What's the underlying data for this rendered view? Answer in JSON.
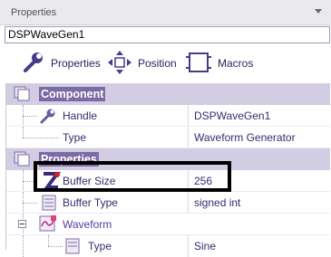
{
  "panel": {
    "title": "Properties"
  },
  "object_selector": {
    "value": "DSPWaveGen1"
  },
  "toolbar": {
    "properties_label": "Properties",
    "position_label": "Position",
    "macros_label": "Macros"
  },
  "categories": {
    "component": {
      "label": "Component"
    },
    "properties": {
      "label": "Properties"
    },
    "waveform": {
      "label": "Waveform"
    }
  },
  "rows": {
    "handle": {
      "name": "Handle",
      "value": "DSPWaveGen1"
    },
    "type": {
      "name": "Type",
      "value": "Waveform Generator"
    },
    "buffer_size": {
      "name": "Buffer Size",
      "value": "256"
    },
    "buffer_type": {
      "name": "Buffer Type",
      "value": "signed int"
    },
    "wave_type": {
      "name": "Type",
      "value": "Sine"
    }
  },
  "colors": {
    "category_bg": "#d3cde3",
    "category_label_bg": "#7c6aa4",
    "text": "#3a2a70"
  }
}
